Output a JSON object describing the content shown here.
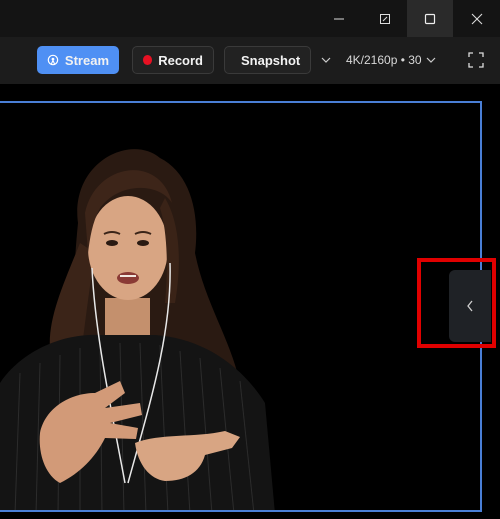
{
  "window_controls": {
    "minimize_icon": "minimize-icon",
    "restore_icon": "popout-icon",
    "maximize_icon": "maximize-icon",
    "close_icon": "close-icon"
  },
  "toolbar": {
    "stream_label": "Stream",
    "record_label": "Record",
    "snapshot_label": "Snapshot",
    "resolution_label": "4K/2160p • 30"
  },
  "colors": {
    "accent": "#4f90f4",
    "record": "#e81123",
    "frame_border": "#4a7fd6",
    "highlight": "#e00000"
  }
}
